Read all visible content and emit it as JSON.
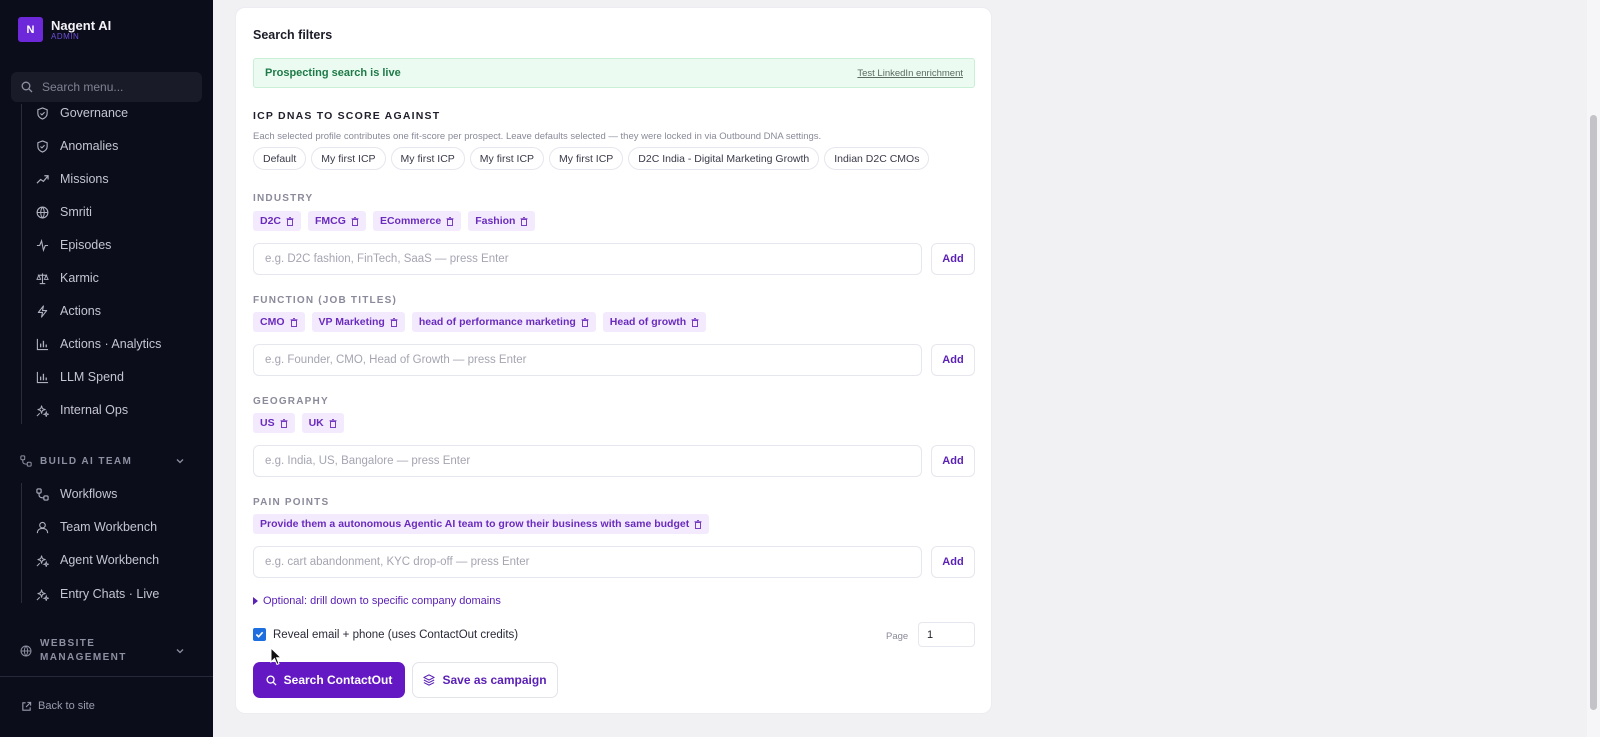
{
  "brand": {
    "logo_letter": "N",
    "name": "Nagent AI",
    "role": "ADMIN"
  },
  "sidebar": {
    "search_placeholder": "Search menu...",
    "items": [
      {
        "label": "Governance",
        "icon": "shield-check-icon"
      },
      {
        "label": "Anomalies",
        "icon": "shield-check-icon"
      },
      {
        "label": "Missions",
        "icon": "trending-up-icon"
      },
      {
        "label": "Smriti",
        "icon": "globe-icon"
      },
      {
        "label": "Episodes",
        "icon": "activity-icon"
      },
      {
        "label": "Karmic",
        "icon": "scale-icon"
      },
      {
        "label": "Actions",
        "icon": "zap-icon"
      },
      {
        "label": "Actions · Analytics",
        "icon": "bar-chart-icon"
      },
      {
        "label": "LLM Spend",
        "icon": "bar-chart-icon"
      },
      {
        "label": "Internal Ops",
        "icon": "sparkles-icon"
      }
    ],
    "section_build": {
      "title": "BUILD AI TEAM",
      "items": [
        {
          "label": "Workflows",
          "icon": "workflow-icon"
        },
        {
          "label": "Team Workbench",
          "icon": "users-icon"
        },
        {
          "label": "Agent Workbench",
          "icon": "sparkles-icon"
        },
        {
          "label": "Entry Chats · Live",
          "icon": "sparkles-icon"
        }
      ]
    },
    "section_website": {
      "title_line1": "WEBSITE",
      "title_line2": "MANAGEMENT"
    },
    "back_link": "Back to site"
  },
  "filters": {
    "title": "Search filters",
    "banner": {
      "text": "Prospecting search is live",
      "link": "Test LinkedIn enrichment"
    },
    "icp": {
      "label": "ICP DNAS TO SCORE AGAINST",
      "hint": "Each selected profile contributes one fit-score per prospect. Leave defaults selected — they were locked in via Outbound DNA settings.",
      "options": [
        "Default",
        "My first ICP",
        "My first ICP",
        "My first ICP",
        "My first ICP",
        "D2C India - Digital Marketing Growth",
        "Indian D2C CMOs"
      ]
    },
    "industry": {
      "label": "INDUSTRY",
      "tags": [
        "D2C",
        "FMCG",
        "ECommerce",
        "Fashion"
      ],
      "placeholder": "e.g. D2C fashion, FinTech, SaaS — press Enter",
      "add": "Add"
    },
    "function": {
      "label": "FUNCTION (JOB TITLES)",
      "tags": [
        "CMO",
        "VP Marketing",
        "head of performance marketing",
        "Head of growth"
      ],
      "placeholder": "e.g. Founder, CMO, Head of Growth — press Enter",
      "add": "Add"
    },
    "geography": {
      "label": "GEOGRAPHY",
      "tags": [
        "US",
        "UK"
      ],
      "placeholder": "e.g. India, US, Bangalore — press Enter",
      "add": "Add"
    },
    "pain_points": {
      "label": "PAIN POINTS",
      "tags": [
        "Provide them a autonomous Agentic AI team to grow their business with same budget"
      ],
      "placeholder": "e.g. cart abandonment, KYC drop-off — press Enter",
      "add": "Add"
    },
    "drill_down": "Optional: drill down to specific company domains",
    "reveal": {
      "label": "Reveal email + phone (uses ContactOut credits)",
      "checked": true
    },
    "page": {
      "label": "Page",
      "value": "1"
    },
    "search_button": "Search ContactOut",
    "campaign_button": "Save as campaign"
  },
  "colors": {
    "accent": "#6418c3",
    "sidebar_bg": "#0c0d1a",
    "tag_bg": "#f3ebfd",
    "live_green": "#1e7a48"
  }
}
